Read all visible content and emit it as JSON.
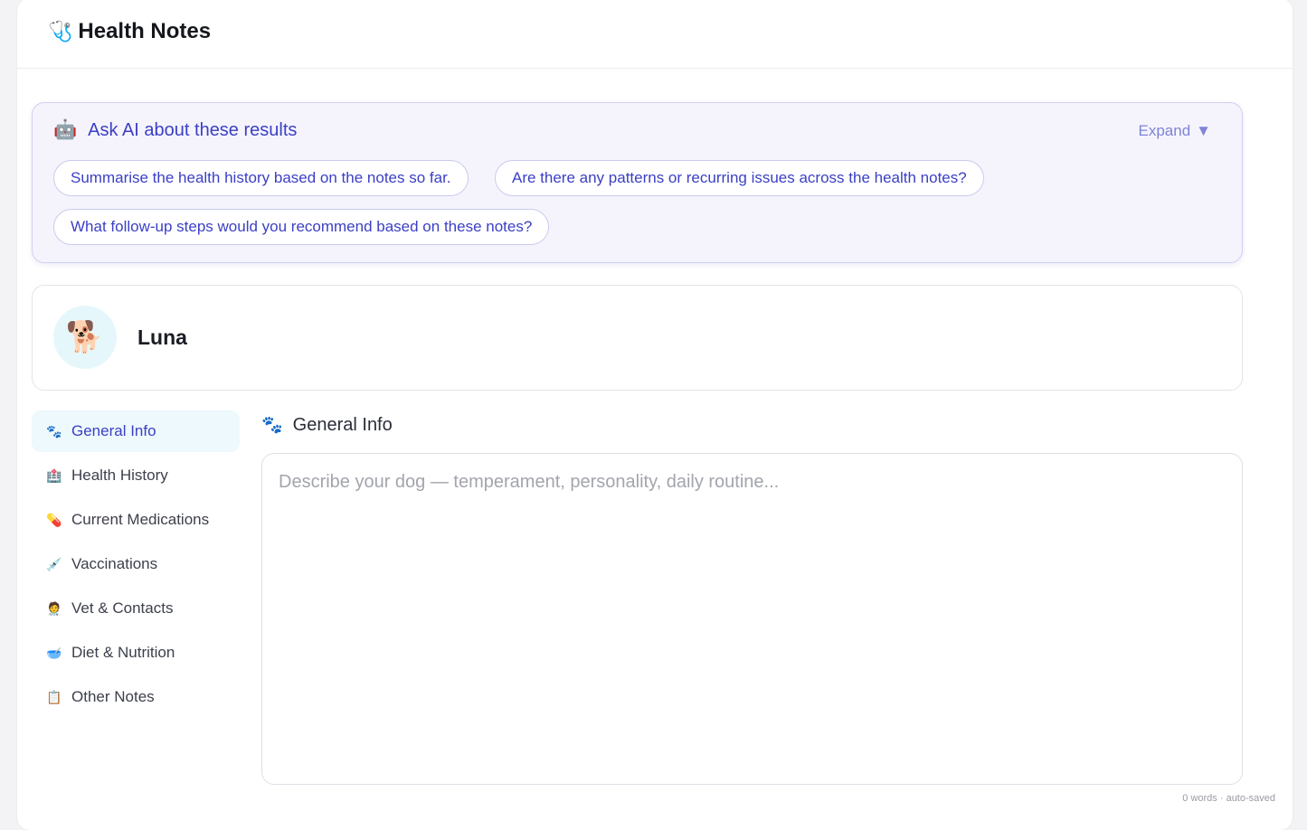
{
  "app": {
    "title": "Health Notes",
    "icon": "stethoscope-icon"
  },
  "ai_panel": {
    "title": "Ask AI about these results",
    "expand_label": "Expand",
    "suggestions": [
      "Summarise the health history based on the notes so far.",
      "Are there any patterns or recurring issues across the health notes?",
      "What follow-up steps would you recommend based on these notes?"
    ]
  },
  "pet": {
    "name": "Luna",
    "avatar_icon": "dog-icon"
  },
  "nav": {
    "items": [
      {
        "label": "General Info",
        "icon": "paw-icon",
        "active": true
      },
      {
        "label": "Health History",
        "icon": "hospital-icon"
      },
      {
        "label": "Current Medications",
        "icon": "pill-icon"
      },
      {
        "label": "Vaccinations",
        "icon": "syringe-icon"
      },
      {
        "label": "Vet & Contacts",
        "icon": "health-worker-icon"
      },
      {
        "label": "Diet & Nutrition",
        "icon": "bowl-icon"
      },
      {
        "label": "Other Notes",
        "icon": "clipboard-icon"
      }
    ]
  },
  "section": {
    "title": "General Info",
    "icon": "paw-icon",
    "placeholder": "Describe your dog — temperament, personality, daily routine...",
    "value": ""
  },
  "status": {
    "text": "0 words · auto-saved"
  },
  "colors": {
    "accent": "#3b3fc4",
    "panel_bg": "#f5f4fd",
    "active_nav_bg": "#edf9fc"
  }
}
